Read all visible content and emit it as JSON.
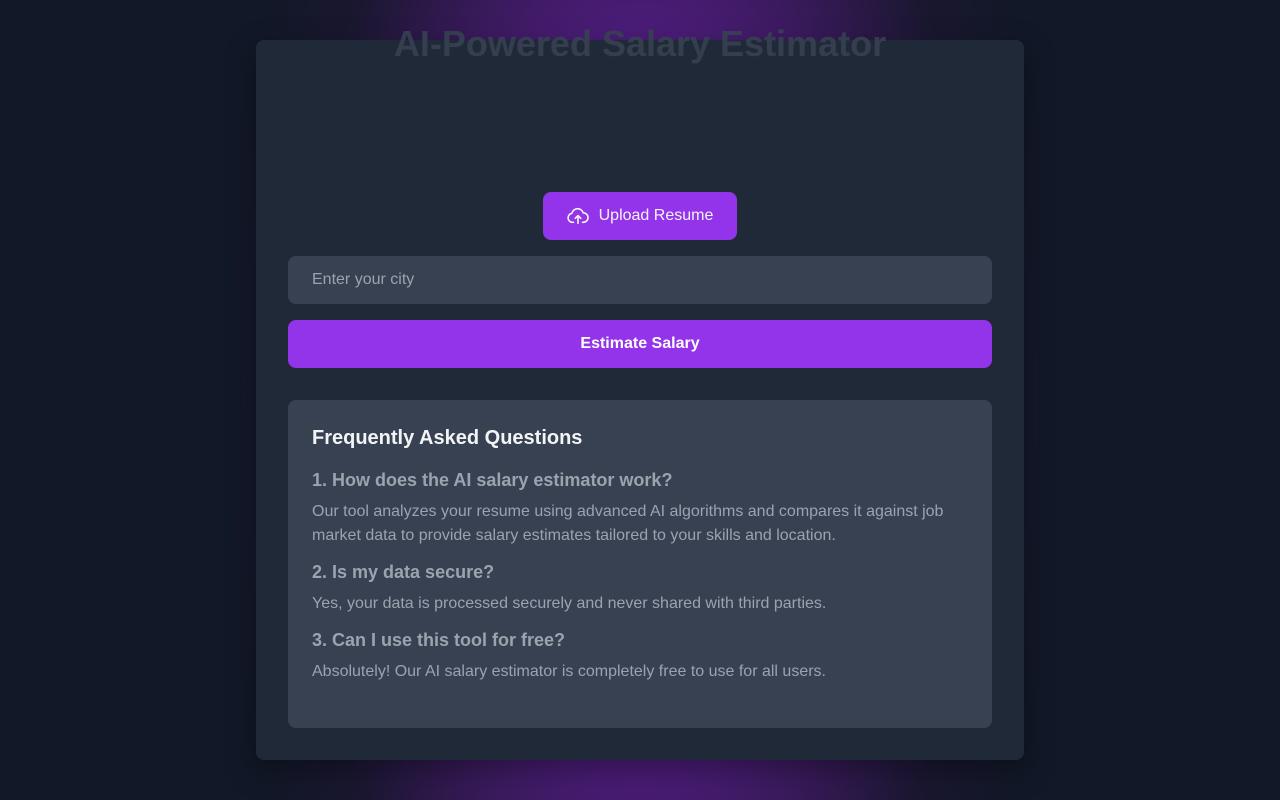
{
  "header": {
    "title": "AI-Powered Salary Estimator"
  },
  "upload": {
    "label": "Upload Resume",
    "icon": "cloud-upload-icon"
  },
  "city_input": {
    "placeholder": "Enter your city",
    "value": ""
  },
  "estimate": {
    "label": "Estimate Salary"
  },
  "faq": {
    "title": "Frequently Asked Questions",
    "items": [
      {
        "question": "1. How does the AI salary estimator work?",
        "answer": "Our tool analyzes your resume using advanced AI algorithms and compares it against job market data to provide salary estimates tailored to your skills and location."
      },
      {
        "question": "2. Is my data secure?",
        "answer": "Yes, your data is processed securely and never shared with third parties."
      },
      {
        "question": "3. Can I use this tool for free?",
        "answer": "Absolutely! Our AI salary estimator is completely free to use for all users."
      }
    ]
  },
  "colors": {
    "accent": "#9333ea",
    "card_background": "#1f2937",
    "panel_background": "#374151"
  }
}
